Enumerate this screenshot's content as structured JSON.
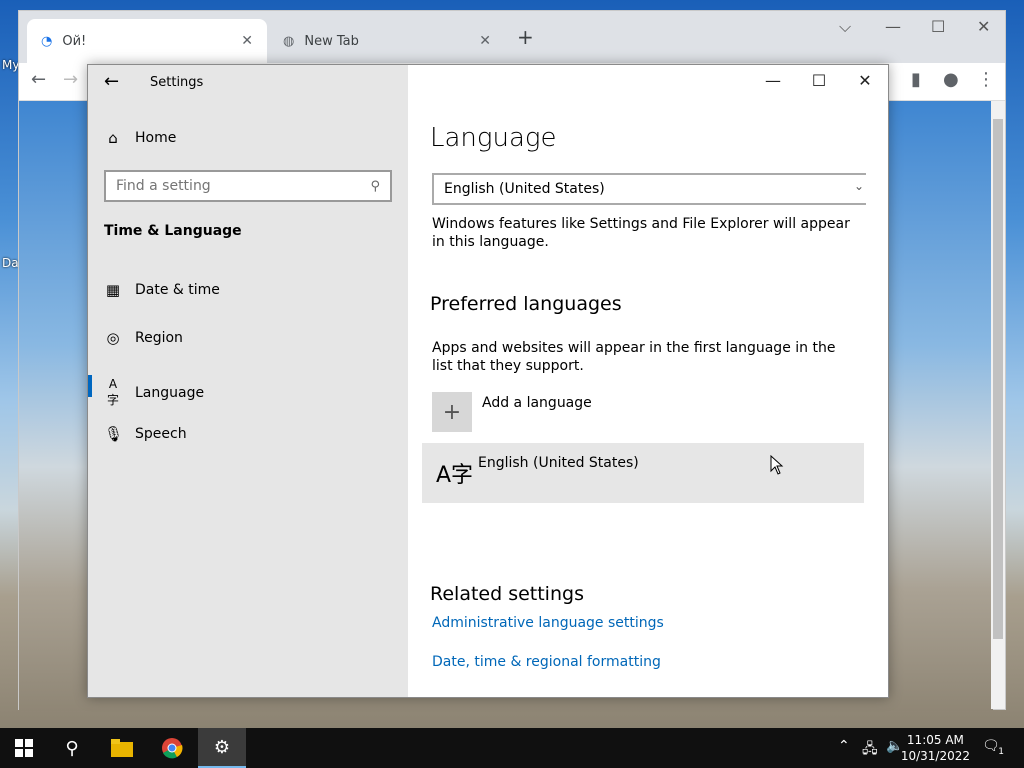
{
  "desktop": {
    "icon_texts": [
      "My",
      "Da"
    ]
  },
  "browser": {
    "tabs": [
      {
        "title": "Ой!",
        "close": "✕"
      },
      {
        "title": "New Tab",
        "close": "✕"
      }
    ],
    "new_tab": "+",
    "controls": {
      "chevron": "⌵",
      "minimize": "—",
      "maximize": "☐",
      "close": "✕"
    }
  },
  "settings": {
    "title": "Settings",
    "back": "←",
    "controls": {
      "minimize": "—",
      "maximize": "☐",
      "close": "✕"
    },
    "sidebar": {
      "home": "Home",
      "search_placeholder": "Find a setting",
      "section": "Time & Language",
      "items": [
        {
          "label": "Date & time"
        },
        {
          "label": "Region"
        },
        {
          "label": "Language"
        },
        {
          "label": "Speech"
        }
      ]
    },
    "main": {
      "title": "Language",
      "display_language": "English (United States)",
      "display_desc": "Windows features like Settings and File Explorer will appear in this language.",
      "preferred_title": "Preferred languages",
      "preferred_desc": "Apps and websites will appear in the first language in the list that they support.",
      "add_language": "Add a language",
      "installed_language": "English (United States)",
      "related_title": "Related settings",
      "links": [
        "Administrative language settings",
        "Date, time & regional formatting"
      ]
    }
  },
  "taskbar": {
    "time": "11:05 AM",
    "date": "10/31/2022",
    "notification_count": "1"
  }
}
